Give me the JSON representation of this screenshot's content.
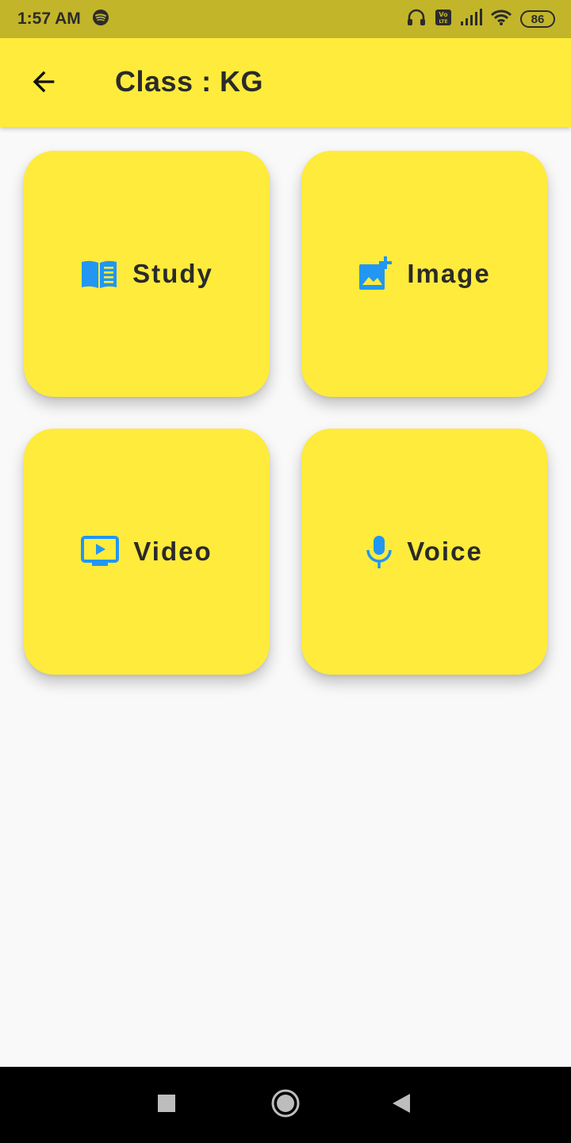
{
  "status_bar": {
    "time": "1:57 AM",
    "battery": "86",
    "icons": [
      "spotify-icon",
      "headset-icon",
      "volte-icon",
      "signal-icon",
      "wifi-icon",
      "battery-icon"
    ]
  },
  "app_bar": {
    "title": "Class : KG",
    "back_icon": "arrow-back-icon",
    "background": "#ffeb3b"
  },
  "cards": [
    {
      "label": "Study",
      "icon": "book-icon"
    },
    {
      "label": "Image",
      "icon": "add-photo-icon"
    },
    {
      "label": "Video",
      "icon": "ondemand-video-icon"
    },
    {
      "label": "Voice",
      "icon": "mic-icon"
    }
  ],
  "colors": {
    "status_bar": "#c2b52a",
    "accent_yellow": "#ffeb3b",
    "icon_blue": "#2196f3",
    "text_dark": "#2a2a2a"
  },
  "nav_bar": {
    "buttons": [
      "recents-square-icon",
      "home-circle-icon",
      "back-triangle-icon"
    ]
  }
}
